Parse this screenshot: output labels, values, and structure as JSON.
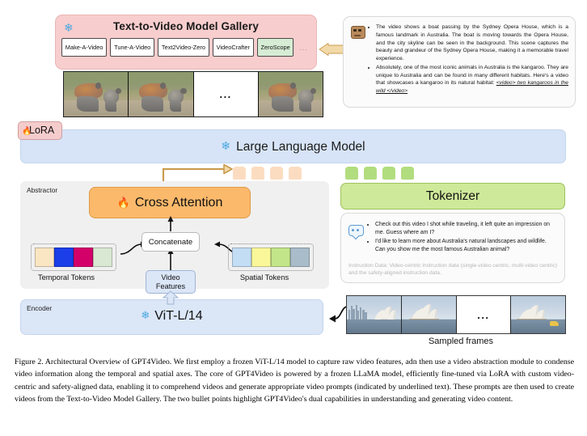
{
  "figure": {
    "caption": "Figure 2. Architectural Overview of GPT4Video. We first employ a frozen ViT-L/14 model to capture raw video features, adn then use a video abstraction module to condense video information along the temporal and spatial axes. The core of GPT4Video is powered by a frozen LLaMA model, efficiently fine-tuned via LoRA with custom video-centric and safety-aligned data, enabling it to comprehend videos and generate appropriate video prompts (indicated by underlined text). These prompts are then used to create videos from the Text-to-Video Model Gallery. The two bullet points highlight GPT4Video's dual capabilities in understanding and generating video content."
  },
  "gallery": {
    "title": "Text-to-Video Model Gallery",
    "frozen_icon": "snowflake-icon",
    "snowflake": "❄",
    "ellipsis": "...",
    "models": [
      {
        "label": "Make-A-Video",
        "selected": false
      },
      {
        "label": "Tune-A-Video",
        "selected": false
      },
      {
        "label": "Text2Video-Zero",
        "selected": false
      },
      {
        "label": "VideoCrafter",
        "selected": false
      },
      {
        "label": "ZeroScope",
        "selected": true
      }
    ]
  },
  "generated_video": {
    "frames_ellipsis": "...",
    "frame_count": 3
  },
  "assistant": {
    "avatar": "robot-avatar-icon",
    "bullets": [
      "The video shows a boat passing by the Sydney Opera House, which is a famous landmark in Australia. The boat is moving towards the Opera House, and the city skyline can be seen in the background. This scene captures the beauty and grandeur of the Sydney Opera House, making it a memorable travel experience.",
      "Absolutely, one of the most iconic animals in Australia is the kangaroo. They are unique to Australia and can be found in many different habitats. Here's a video that showcases a kangaroo in its natural habitat: "
    ],
    "video_prompt": "<video> two kangaroos in the wild </video>"
  },
  "llm": {
    "label": "Large Language Model",
    "snowflake": "❄",
    "frozen_icon": "snowflake-icon"
  },
  "lora": {
    "label": "LoRA",
    "flame": "🔥",
    "flame_icon": "flame-icon"
  },
  "tokens_row": {
    "orange_count": 4,
    "green_count": 4,
    "orange_color": "#fbdcc0",
    "green_color": "#b2dd7f"
  },
  "abstractor": {
    "label": "Abstractor",
    "cross_attention": {
      "label": "Cross Attention",
      "flame": "🔥",
      "flame_icon": "flame-icon",
      "color": "#fbb96b"
    },
    "concatenate": "Concatenate",
    "video_features_line1": "Video",
    "video_features_line2": "Features",
    "temporal": {
      "label": "Temporal Tokens",
      "colors": [
        "#fbe6c3",
        "#1a3ee8",
        "#d4006a",
        "#d9e8d2"
      ]
    },
    "spatial": {
      "label": "Spatial Tokens",
      "colors": [
        "#c3ddf5",
        "#f9f79a",
        "#c3e58a",
        "#a9bcca"
      ]
    }
  },
  "tokenizer": {
    "label": "Tokenizer",
    "color": "#cfe99a"
  },
  "user": {
    "avatar": "user-chat-avatar-icon",
    "bullets": [
      "Check out this video I shot while traveling, it left quite an impression on me. Guess where am I?",
      "I'd like to learn more about Australia's natural landscapes and wildlife. Can you show me the most famous Australian animal?"
    ],
    "instruction_note": "Instruction Data: Video-centric instruction data (single-video centric, multi-video centric) and the safety-aligned instruction data."
  },
  "encoder": {
    "label": "Encoder",
    "model": "ViT-L/14",
    "snowflake": "❄",
    "frozen_icon": "snowflake-icon"
  },
  "sampled_frames": {
    "label": "Sampled frames",
    "ellipsis": "...",
    "frame_count": 3
  }
}
